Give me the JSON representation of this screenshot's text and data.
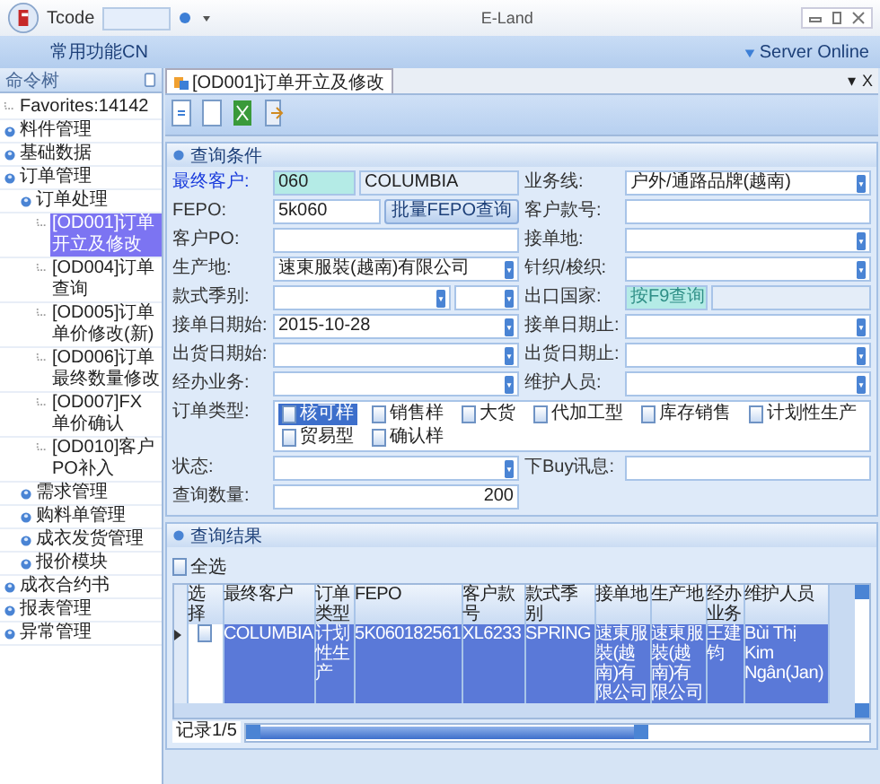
{
  "window": {
    "title": "E-Land",
    "tcode_label": "Tcode"
  },
  "ribbon": {
    "menu": "常用功能CN",
    "status": "Server Online"
  },
  "sidebar": {
    "title": "命令树",
    "tree": [
      {
        "label": "Favorites:14142",
        "kind": "item",
        "selected": false
      },
      {
        "label": "料件管理",
        "kind": "group",
        "selected": false
      },
      {
        "label": "基础数据",
        "kind": "group",
        "selected": false
      },
      {
        "label": "订单管理",
        "kind": "group",
        "selected": false,
        "children": [
          {
            "label": "订单处理",
            "kind": "group",
            "selected": false,
            "children": [
              {
                "label": "[OD001]订单开立及修改",
                "kind": "item",
                "selected": true
              },
              {
                "label": "[OD004]订单查询",
                "kind": "item",
                "selected": false
              },
              {
                "label": "[OD005]订单单价修改(新)",
                "kind": "item",
                "selected": false
              },
              {
                "label": "[OD006]订单最终数量修改",
                "kind": "item",
                "selected": false
              },
              {
                "label": "[OD007]FX单价确认",
                "kind": "item",
                "selected": false
              },
              {
                "label": "[OD010]客户PO补入",
                "kind": "item",
                "selected": false
              }
            ]
          },
          {
            "label": "需求管理",
            "kind": "group",
            "selected": false
          },
          {
            "label": "购料单管理",
            "kind": "group",
            "selected": false
          },
          {
            "label": "成衣发货管理",
            "kind": "group",
            "selected": false
          },
          {
            "label": "报价模块",
            "kind": "group",
            "selected": false
          }
        ]
      },
      {
        "label": "成衣合约书",
        "kind": "group",
        "selected": false
      },
      {
        "label": "报表管理",
        "kind": "group",
        "selected": false
      },
      {
        "label": "异常管理",
        "kind": "group",
        "selected": false
      }
    ]
  },
  "tabs": [
    {
      "label": "[OD001]订单开立及修改",
      "selected": true
    }
  ],
  "tab_controls": [
    "▾",
    "X"
  ],
  "query": {
    "title": "查询条件",
    "fields": [
      {
        "label": "最终客户:",
        "kind": "lookup",
        "required": true,
        "code": "060",
        "name": "COLUMBIA"
      },
      {
        "label": "业务线:",
        "kind": "select",
        "required": false,
        "value": "户外/通路品牌(越南)"
      },
      {
        "label": "FEPO:",
        "kind": "text",
        "required": false,
        "value": "5k060",
        "button": "批量FEPO查询"
      },
      {
        "label": "客户款号:",
        "kind": "text",
        "required": false
      },
      {
        "label": "客户PO:",
        "kind": "text",
        "required": false
      },
      {
        "label": "接单地:",
        "kind": "select",
        "required": false
      },
      {
        "label": "生产地:",
        "kind": "select",
        "required": false,
        "value": "速東服裝(越南)有限公司"
      },
      {
        "label": "针织/梭织:",
        "kind": "select",
        "required": false
      },
      {
        "label": "款式季别:",
        "kind": "double-select",
        "required": false
      },
      {
        "label": "出口国家:",
        "kind": "lookup",
        "required": false,
        "placeholder": "按F9查询"
      },
      {
        "label": "接单日期始:",
        "kind": "select",
        "required": false,
        "value": "2015-10-28"
      },
      {
        "label": "接单日期止:",
        "kind": "select",
        "required": false
      },
      {
        "label": "出货日期始:",
        "kind": "select",
        "required": false
      },
      {
        "label": "出货日期止:",
        "kind": "select",
        "required": false
      },
      {
        "label": "经办业务:",
        "kind": "select",
        "required": false
      },
      {
        "label": "维护人员:",
        "kind": "select",
        "required": false
      },
      {
        "label": "订单类型:",
        "kind": "checks",
        "required": false,
        "options": [
          {
            "label": "核可样",
            "checked": false,
            "focused": true
          },
          {
            "label": "销售样",
            "checked": false,
            "focused": false
          },
          {
            "label": "大货",
            "checked": false,
            "focused": false
          },
          {
            "label": "代加工型",
            "checked": false,
            "focused": false
          },
          {
            "label": "库存销售",
            "checked": false,
            "focused": false
          },
          {
            "label": "计划性生产",
            "checked": false,
            "focused": false
          },
          {
            "label": "贸易型",
            "checked": false,
            "focused": false
          },
          {
            "label": "确认样",
            "checked": false,
            "focused": false
          }
        ]
      },
      {
        "label": "状态:",
        "kind": "select",
        "required": false
      },
      {
        "label": "下Buy讯息:",
        "kind": "text",
        "required": false
      },
      {
        "label": "查询数量:",
        "kind": "number",
        "required": false,
        "value": "200"
      }
    ]
  },
  "results": {
    "title": "查询结果",
    "select_all": {
      "label": "全选",
      "checked": false
    },
    "select_column": "选择",
    "columns": [
      "最终客户",
      "订单类型",
      "FEPO",
      "客户款号",
      "款式季别",
      "接单地",
      "生产地",
      "经办业务",
      "维护人员"
    ],
    "rows": [
      {
        "selected": true,
        "checked": false,
        "cells": [
          "COLUMBIA",
          "计划性生产",
          "5K060182561",
          "XL6233",
          "SPRING",
          "速東服裝(越南)有限公司",
          "速東服裝(越南)有限公司",
          "王建钧",
          "Bùi Thị Kim Ngân(Jan)"
        ]
      }
    ],
    "record": "记录1/5"
  }
}
